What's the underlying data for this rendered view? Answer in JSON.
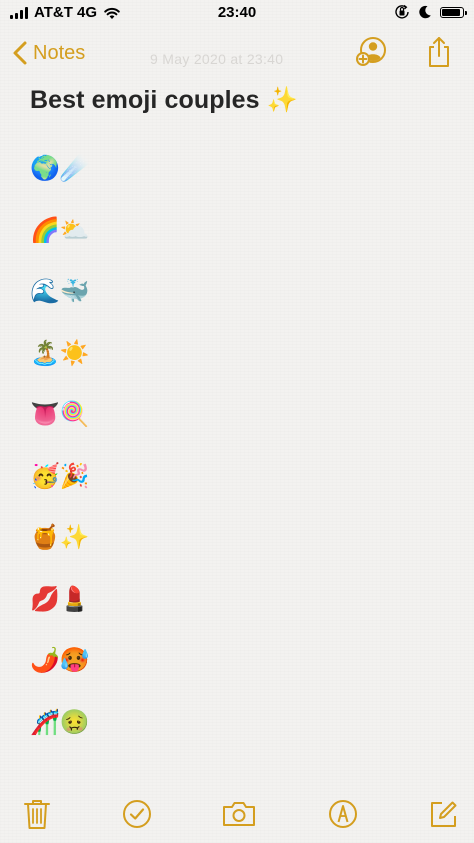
{
  "status_bar": {
    "carrier": "AT&T 4G",
    "time": "23:40"
  },
  "nav": {
    "back_label": "Notes",
    "date_text": "9 May 2020 at 23:40"
  },
  "note": {
    "title": "Best emoji couples ✨",
    "pairs": [
      "🌍☄️",
      "🌈⛅",
      "🌊🐳",
      "🏝️☀️",
      "👅🍭",
      "🥳🎉",
      "🍯✨",
      "💋💄",
      "🌶️🥵",
      "🎢🤢"
    ]
  },
  "toolbar": {
    "icons": [
      "trash-icon",
      "checklist-icon",
      "camera-icon",
      "markup-icon",
      "compose-icon"
    ]
  },
  "colors": {
    "accent": "#d49e1f",
    "background": "#f3f2f0",
    "title": "#262626"
  }
}
